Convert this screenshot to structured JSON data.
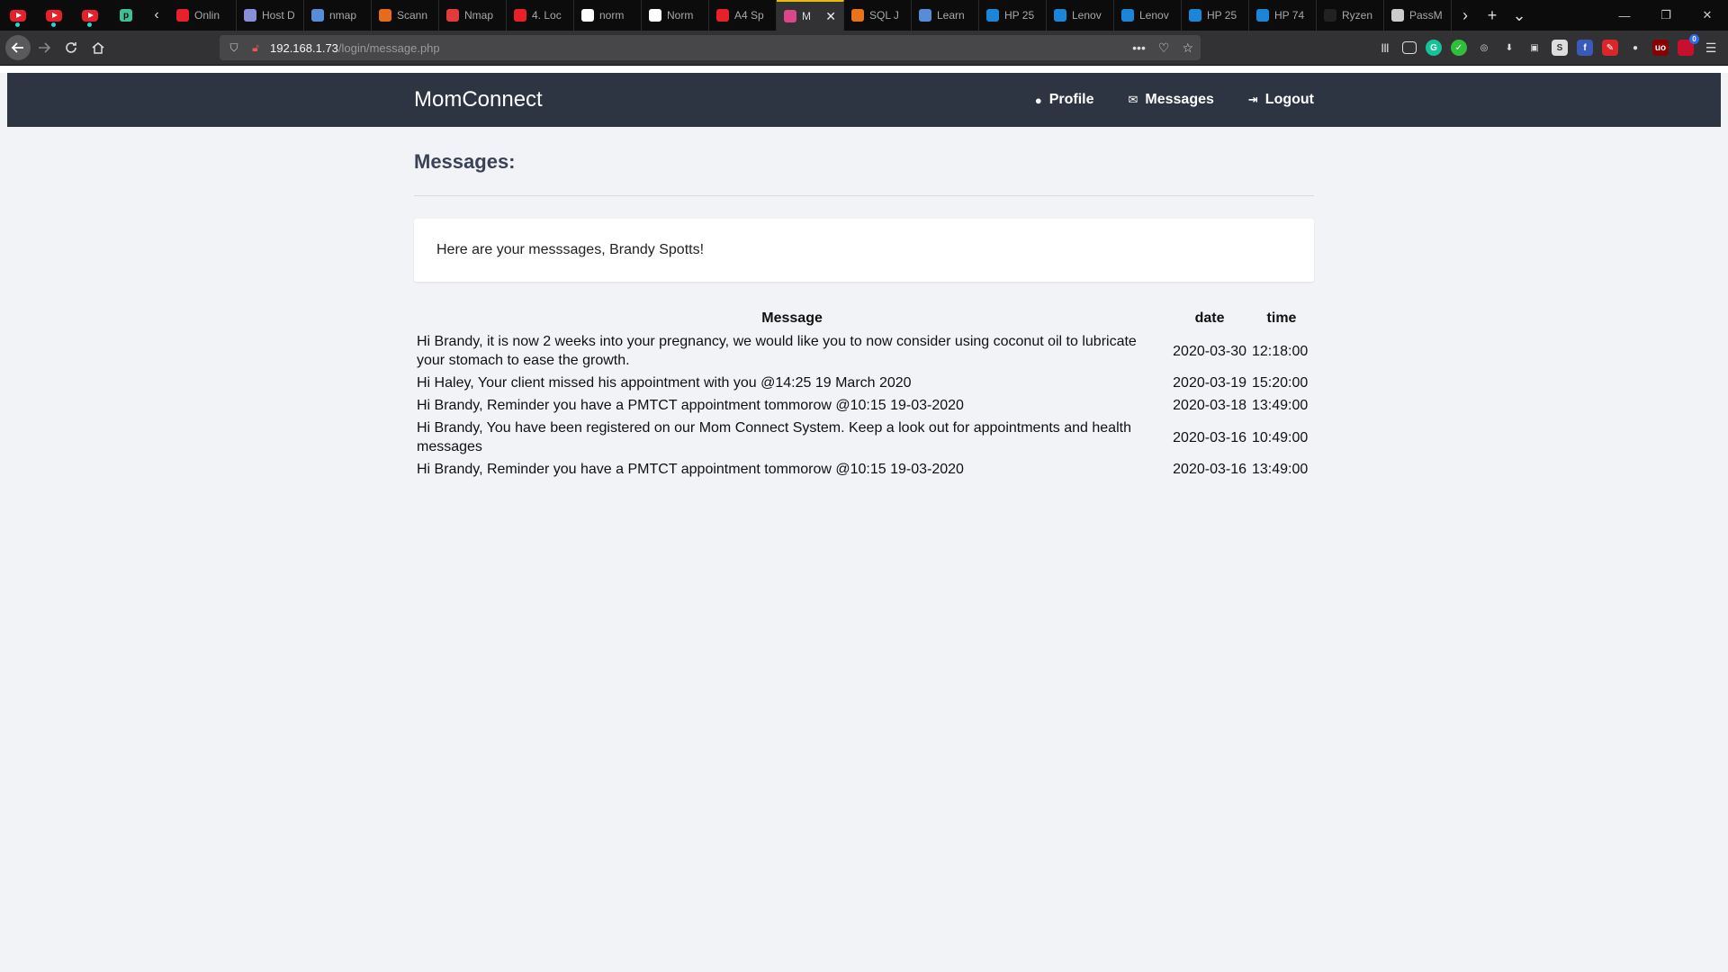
{
  "browser": {
    "tabs": [
      {
        "label": "Onlin",
        "icon": "adobe-icon",
        "color": "#e6212b"
      },
      {
        "label": "Host D",
        "icon": "eye-icon",
        "color": "#8a8dd8"
      },
      {
        "label": "nmap",
        "icon": "shield-icon",
        "color": "#5a8bd6"
      },
      {
        "label": "Scann",
        "icon": "terminal-icon",
        "color": "#e66b1a"
      },
      {
        "label": "Nmap",
        "icon": "target-icon",
        "color": "#e23b3b"
      },
      {
        "label": "4. Loc",
        "icon": "opera-icon",
        "color": "#e8202a"
      },
      {
        "label": "norm",
        "icon": "google-icon",
        "color": "#ffffff"
      },
      {
        "label": "Norm",
        "icon": "excel-icon",
        "color": "#ffffff"
      },
      {
        "label": "A4 Sp",
        "icon": "dots-icon",
        "color": "#e8202a"
      },
      {
        "label": "M",
        "icon": "app-icon",
        "color": "#d9468a",
        "active": true
      },
      {
        "label": "SQL J",
        "icon": "sql-icon",
        "color": "#e8731a"
      },
      {
        "label": "Learn",
        "icon": "home-icon",
        "color": "#5a8bd6"
      },
      {
        "label": "HP 25",
        "icon": "t-icon",
        "color": "#1b86d8"
      },
      {
        "label": "Lenov",
        "icon": "t-icon",
        "color": "#1b86d8"
      },
      {
        "label": "Lenov",
        "icon": "t-icon",
        "color": "#1b86d8"
      },
      {
        "label": "HP 25",
        "icon": "t-icon",
        "color": "#1b86d8"
      },
      {
        "label": "HP 74",
        "icon": "t-icon",
        "color": "#1b86d8"
      },
      {
        "label": "Ryzen",
        "icon": "blank-icon",
        "color": "#222222"
      },
      {
        "label": "PassM",
        "icon": "pass-icon",
        "color": "#cccccc"
      }
    ],
    "url_host": "192.168.1.73",
    "url_path": "/login/message.php",
    "badge_count": "0"
  },
  "site": {
    "brand": "MomConnect",
    "nav": {
      "profile": "Profile",
      "messages": "Messages",
      "logout": "Logout"
    }
  },
  "page": {
    "title": "Messages:",
    "greeting": "Here are your messsages, Brandy Spotts!",
    "table": {
      "headers": {
        "message": "Message",
        "date": "date",
        "time": "time"
      },
      "rows": [
        {
          "message": "Hi Brandy, it is now 2 weeks into your pregnancy, we would like you to now consider using coconut oil to lubricate your stomach to ease the growth.",
          "date": "2020-03-30",
          "time": "12:18:00"
        },
        {
          "message": "Hi Haley, Your client missed his appointment with you @14:25 19 March 2020",
          "date": "2020-03-19",
          "time": "15:20:00"
        },
        {
          "message": "Hi Brandy, Reminder you have a PMTCT appointment tommorow @10:15 19-03-2020",
          "date": "2020-03-18",
          "time": "13:49:00"
        },
        {
          "message": "Hi Brandy, You have been registered on our Mom Connect System. Keep a look out for appointments and health messages",
          "date": "2020-03-16",
          "time": "10:49:00"
        },
        {
          "message": "Hi Brandy, Reminder you have a PMTCT appointment tommorow @10:15 19-03-2020",
          "date": "2020-03-16",
          "time": "13:49:00"
        }
      ]
    }
  }
}
